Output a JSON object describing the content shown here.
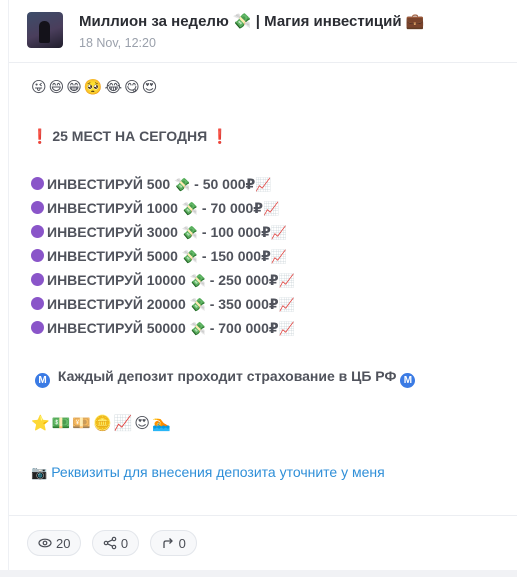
{
  "channel": {
    "title": "Миллион за неделю 💸 | Магия инвестиций 💼",
    "date": "18 Nov, 12:20"
  },
  "post": {
    "emoji_row_1": "😜😄😁🥺😂😋😍",
    "headline_icon": "❗",
    "headline": "25 МЕСТ НА СЕГОДНЯ",
    "offers": [
      {
        "text": "ИНВЕСТИРУЙ 500",
        "money_icon": "💸",
        "result": " - 50 000₽",
        "chart_icon": "📈"
      },
      {
        "text": "ИНВЕСТИРУЙ 1000",
        "money_icon": "💸",
        "result": " - 70 000₽",
        "chart_icon": "📈"
      },
      {
        "text": "ИНВЕСТИРУЙ 3000",
        "money_icon": "💸",
        "result": " - 100 000₽",
        "chart_icon": "📈"
      },
      {
        "text": "ИНВЕСТИРУЙ 5000",
        "money_icon": "💸",
        "result": " - 150 000₽",
        "chart_icon": "📈"
      },
      {
        "text": "ИНВЕСТИРУЙ 10000",
        "money_icon": "💸",
        "result": " - 250 000₽",
        "chart_icon": "📈"
      },
      {
        "text": "ИНВЕСТИРУЙ 20000",
        "money_icon": "💸",
        "result": " - 350 000₽",
        "chart_icon": "📈"
      },
      {
        "text": "ИНВЕСТИРУЙ 50000",
        "money_icon": "💸",
        "result": " - 700 000₽",
        "chart_icon": "📈"
      }
    ],
    "m_icon": "M",
    "insurance_text": "Каждый депозит проходит страхование в ЦБ РФ",
    "emoji_row_2": "⭐💵💴🪙📈😍🏊",
    "link_icon": "📷",
    "link_text": "Реквизиты для внесения депозита уточните у меня"
  },
  "stats": {
    "views": "20",
    "shares": "0",
    "forwards": "0"
  }
}
